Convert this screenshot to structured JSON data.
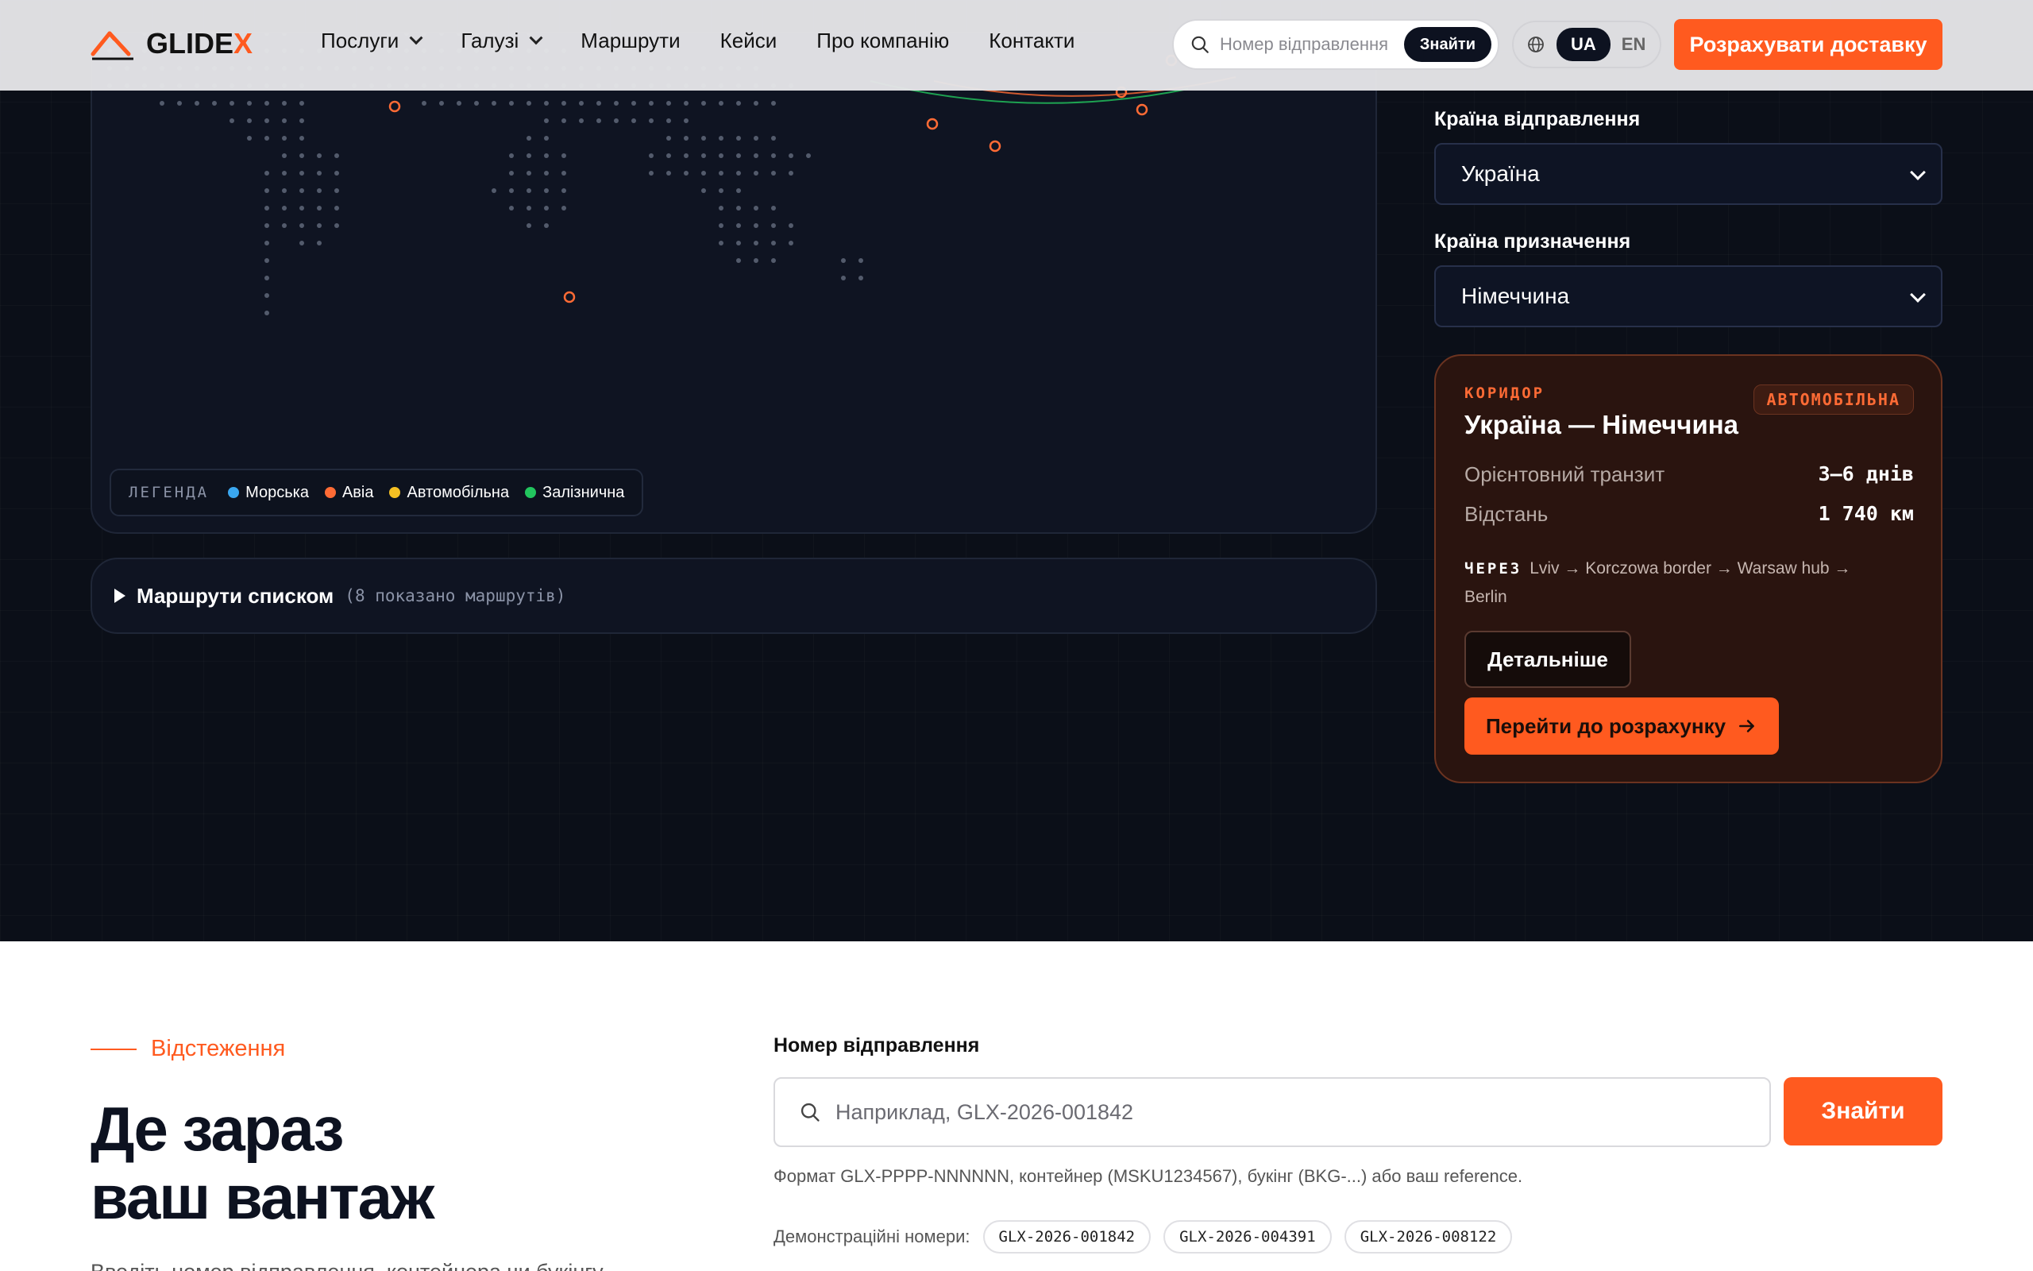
{
  "header": {
    "logo_text_main": "GLIDE",
    "logo_text_accent": "X",
    "nav": [
      {
        "label": "Послуги",
        "has_dropdown": true
      },
      {
        "label": "Галузі",
        "has_dropdown": true
      },
      {
        "label": "Маршрути"
      },
      {
        "label": "Кейси"
      },
      {
        "label": "Про компанію"
      },
      {
        "label": "Контакти"
      }
    ],
    "search_placeholder": "Номер відправлення",
    "search_button": "Знайти",
    "lang_active": "UA",
    "lang_other": "EN",
    "cta": "Розрахувати доставку"
  },
  "map": {
    "legend_title": "ЛЕГЕНДА",
    "legend": [
      {
        "label": "Морська",
        "color": "#3aa7f0"
      },
      {
        "label": "Авіа",
        "color": "#ff6b35"
      },
      {
        "label": "Автомобільна",
        "color": "#f5c023"
      },
      {
        "label": "Залізнична",
        "color": "#22c55e"
      }
    ],
    "routes_list_title": "Маршрути списком",
    "routes_list_count": "(8 показано маршрутів)"
  },
  "form": {
    "origin_label": "Країна відправлення",
    "origin_value": "Україна",
    "dest_label": "Країна призначення",
    "dest_value": "Німеччина"
  },
  "corridor": {
    "kicker": "КОРИДОР",
    "title": "Україна — Німеччина",
    "badge": "АВТОМОБІЛЬНА",
    "transit_label": "Орієнтовний транзит",
    "transit_value": "3–6 днів",
    "distance_label": "Відстань",
    "distance_value": "1 740 км",
    "via_label": "ЧЕРЕЗ",
    "via_value": "Lviv → Korczowa border → Warsaw hub → Berlin",
    "details_button": "Детальніше",
    "go_button": "Перейти до розрахунку"
  },
  "tracking": {
    "eyebrow": "Відстеження",
    "title_line1": "Де зараз",
    "title_line2": "ваш вантаж",
    "subtitle": "Введіть номер відправлення, контейнера чи букінгу",
    "input_label": "Номер відправлення",
    "input_placeholder": "Наприклад, GLX-2026-001842",
    "search_button": "Знайти",
    "hint": "Формат GLX-PPPP-NNNNNN, контейнер (MSKU1234567), букінг (BKG-...) або ваш reference.",
    "demo_label": "Демонстраційні номери:",
    "demo_numbers": [
      "GLX-2026-001842",
      "GLX-2026-004391",
      "GLX-2026-008122"
    ]
  },
  "colors": {
    "accent": "#ff5a1f",
    "dark_bg": "#0b0f18",
    "card_bg": "#2a140f"
  }
}
